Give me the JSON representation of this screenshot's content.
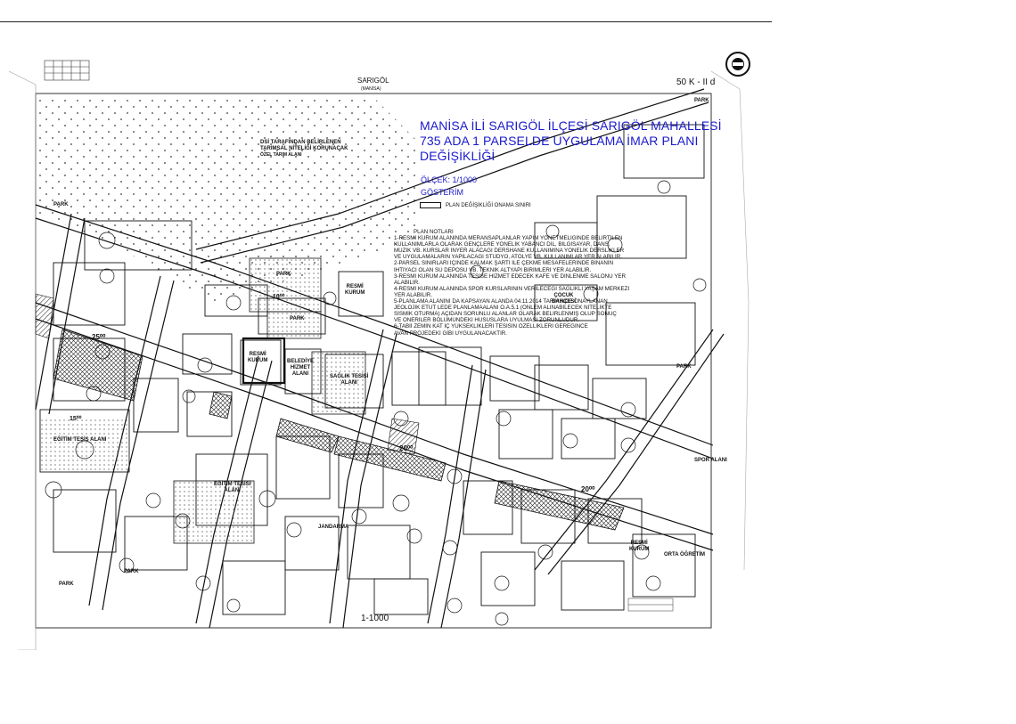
{
  "header": {
    "place_name": "SARIGÖL",
    "place_sub": "(MANİSA)",
    "sheet_code": "50 K - II d",
    "scale_bottom": "1-1000"
  },
  "plan": {
    "title_lines": [
      "MANİSA İLİ SARIGÖL İLÇESİ SARIGÖL MAHALLESİ",
      "735 ADA 1 PARSELDE UYGULAMA İMAR PLANI",
      "DEĞİŞİKLİĞİ"
    ],
    "scale": "ÖLÇEK: 1/1000",
    "legend_title": "GÖSTERİM",
    "legend_item": "PLAN DEĞİŞİKLİĞİ ONAMA SINIRI",
    "notes_header": "PLAN NOTLARI",
    "notes": [
      "1-RESMİ KURUM ALANINDA MERANSAPLANLAR YAPIM YÖNETMELİĞİNDE BELİRTİLEN",
      "KULLANIMLARLA OLARAK GENÇLERE YÖNELİK YABANCI DİL, BİLGİSAYAR, DANS,",
      "MÜZİK VB. KURSLAR İNYER ALACAĞI DERSHANE KULLANIMINA YÖNELİK DERSLİKLER",
      "VE UYGULAMALARIN YAPILACAĞI STÜDYO, ATÖLYE VB. KULLANIMLAR YER ALABİLİR.",
      "2-PARSEL SINIRLARI İÇİNDE KALMAK ŞARTI İLE ÇEKME MESAFELERİNDE BİNANIN",
      "İHTİYACI OLAN SU DEPOSU VB. TEKNİK ALTYAPI BİRİMLERİ YER ALABİLİR.",
      "3-RESMİ KURUM ALANINDA TESİSE HİZMET EDECEK KAFE VE DİNLENME SALONU YER",
      "ALABİLİR.",
      "4-RESMİ KURUM ALANINDA SPOR KURSLARININ VERİLECEĞİ SAĞLIKLI YAŞAM MERKEZİ",
      "YER ALABİLİR.",
      "5-PLANLAMA ALANINI DA KAPSAYAN ALANDA 04.11.2014 TARİHİNDE ONAYLANAN",
      "JEOLOJİK ETÜT LEDE PLANLAMAALANI O.A.5.1 (ÖNLEM ALINABİLECEK NİTELİKTE",
      "SİSMİK OTURMA) AÇIDAN SORUNLU ALANLAR OLARAK BELİRLENMİŞ OLUP SONUÇ",
      "VE ÖNERİLER BÖLÜMÜNDEKİ HUSUSLARA UYULMASI ZORUNLUDUR.",
      "6-TABİİ ZEMİN KAT İÇ YÜKSEKLİKLERİ TESİSİN ÖZELLİKLERİ GEREĞİNCE",
      "AVAN PROJEDEKİ GİBİ UYGULANACAKTIR."
    ]
  },
  "map_labels": {
    "dsi": [
      "DSİ TARAFINDAN BELİRLENEN",
      "TARIMSAL NİTELİĞİ KORUNACAK",
      "ÖZEL TARIM ALANI"
    ],
    "park_1": "PARK",
    "park_2": "PARK",
    "park_3": "PARK",
    "park_4": "PARK",
    "park_5": "PARK",
    "park_6": "PARK",
    "park_7": "PARK",
    "resmi_1": [
      "RESMİ",
      "KURUM"
    ],
    "resmi_2": [
      "RESMİ",
      "KURUM"
    ],
    "resmi_3": [
      "RESMİ",
      "KURUM"
    ],
    "belediye": [
      "BELEDİYE",
      "HİZMET",
      "ALANI"
    ],
    "saglik": [
      "SAĞLIK TESİSİ",
      "ALANI"
    ],
    "egitim_1": "EĞİTİM TESİS ALANI",
    "egitim_2": [
      "EĞİTİM TESİSİ",
      "ALANI"
    ],
    "jandarma": "JANDARMA",
    "spor": "SPOR ALANI",
    "ortaogretim": "ORTA ÖĞRETİM",
    "cocuk": [
      "ÇOCUK",
      "BAHÇESİ"
    ],
    "road_1": "25⁰⁰",
    "road_2": "20⁰⁰",
    "road_3": "20⁰⁰",
    "road_4": "10⁰⁰",
    "road_5": "15⁰⁰"
  }
}
